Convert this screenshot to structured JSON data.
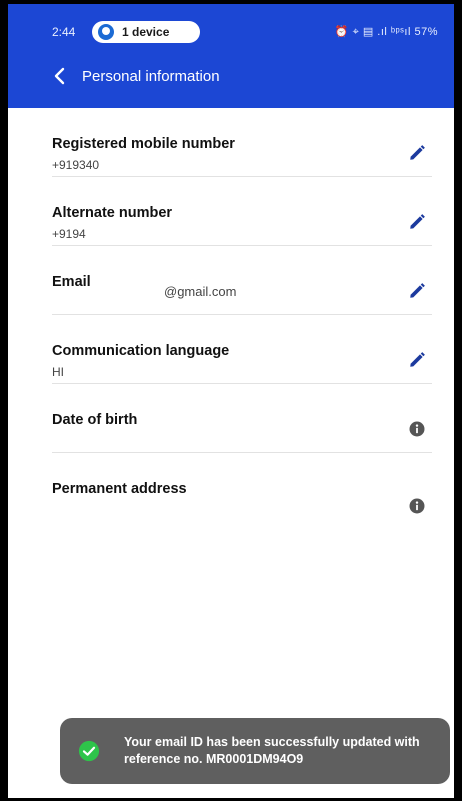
{
  "status_bar": {
    "time": "2:44",
    "device_badge": "1 device",
    "indicators": "⏰ ⌖ ▤ .ıl ᵇᵖˢıl 57%",
    "battery": "57%"
  },
  "header": {
    "title": "Personal information",
    "back_icon": "chevron-left-icon",
    "color": "#1c47d4"
  },
  "rows": [
    {
      "label": "Registered mobile number",
      "value": "+919340",
      "action_icon": "pencil-icon"
    },
    {
      "label": "Alternate number",
      "value": "+9194",
      "action_icon": "pencil-icon"
    },
    {
      "label": "Email",
      "value": "@gmail.com",
      "action_icon": "pencil-icon"
    },
    {
      "label": "Communication language",
      "value": "HI",
      "action_icon": "pencil-icon"
    },
    {
      "label": "Date of birth",
      "value": "",
      "action_icon": "info-icon"
    },
    {
      "label": "Permanent address",
      "value": "",
      "action_icon": "info-icon"
    }
  ],
  "toast": {
    "message": "Your email ID has been successfully updated with reference no. MR0001DM94O9",
    "icon": "check-circle-icon",
    "accent": "#2ec44a"
  }
}
